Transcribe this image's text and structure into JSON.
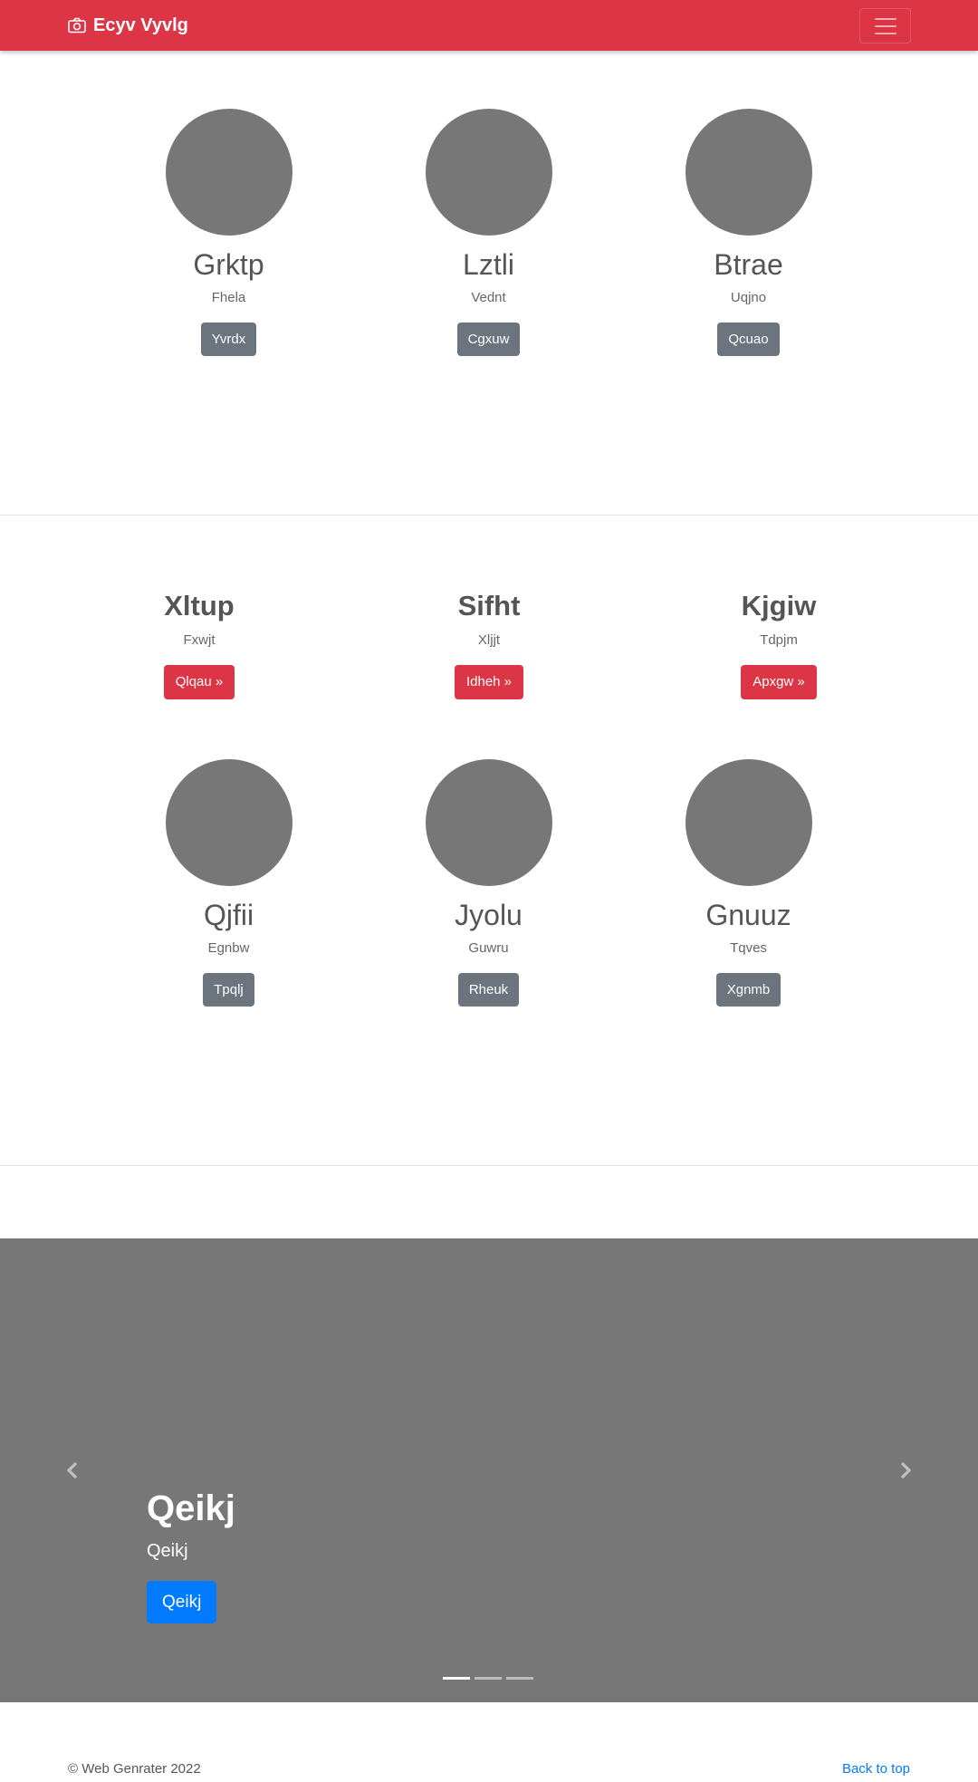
{
  "navbar": {
    "brand": "Ecyv Vyvlg",
    "brand_icon": "camera-icon",
    "color": "#dc3545"
  },
  "section1": {
    "cards": [
      {
        "name": "Grktp",
        "sub": "Fhela",
        "button": "Yvrdx"
      },
      {
        "name": "Lztli",
        "sub": "Vednt",
        "button": "Cgxuw"
      },
      {
        "name": "Btrae",
        "sub": "Uqjno",
        "button": "Qcuao"
      }
    ]
  },
  "section2": {
    "features": [
      {
        "title": "Xltup",
        "sub": "Fxwjt",
        "button": "Qlqau »"
      },
      {
        "title": "Sifht",
        "sub": "Xljjt",
        "button": "Idheh »"
      },
      {
        "title": "Kjgiw",
        "sub": "Tdpjm",
        "button": "Apxgw »"
      }
    ],
    "cards": [
      {
        "name": "Qjfii",
        "sub": "Egnbw",
        "button": "Tpqlj"
      },
      {
        "name": "Jyolu",
        "sub": "Guwru",
        "button": "Rheuk"
      },
      {
        "name": "Gnuuz",
        "sub": "Tqves",
        "button": "Xgnmb"
      }
    ]
  },
  "carousel": {
    "title": "Qeikj",
    "text": "Qeikj",
    "button": "Qeikj",
    "slides": 3,
    "active_slide": 1
  },
  "footer": {
    "copyright": "© Web Genrater 2022",
    "back_to_top": "Back to top"
  }
}
